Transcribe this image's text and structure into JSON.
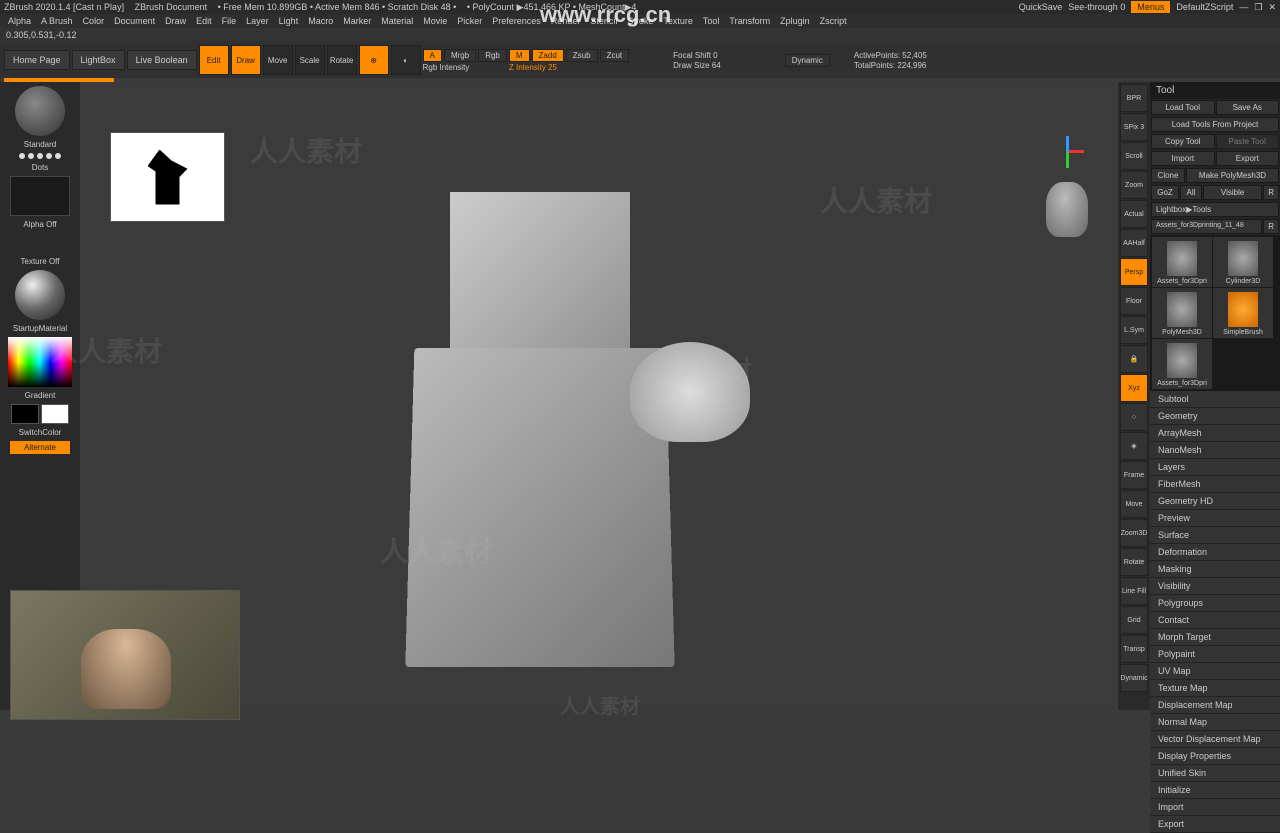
{
  "titlebar": {
    "app": "ZBrush 2020.1.4 [Cast n Play]",
    "doc": "ZBrush Document",
    "mem": "• Free Mem 10.899GB • Active Mem 846 • Scratch Disk 48 •",
    "poly": "• PolyCount ▶451,466 KP • MeshCount▶4",
    "quicksave": "QuickSave",
    "seethrough": "See-through   0",
    "menus": "Menus",
    "script": "DefaultZScript"
  },
  "menubar": [
    "Alpha",
    "A Brush",
    "Color",
    "Document",
    "Draw",
    "Edit",
    "File",
    "Layer",
    "Light",
    "Macro",
    "Marker",
    "Material",
    "Movie",
    "Picker",
    "Preferences",
    "Render",
    "Stencil",
    "Stroke",
    "Texture",
    "Tool",
    "Transform",
    "Zplugin",
    "Zscript"
  ],
  "coords": "0.305,0.531,-0.12",
  "toolbar": {
    "home": "Home Page",
    "lightbox": "LightBox",
    "liveBool": "Live Boolean",
    "edit": "Edit",
    "draw": "Draw",
    "move": "Move",
    "scale": "Scale",
    "rotate": "Rotate",
    "mrgb_a": "A",
    "mrgb": "Mrgb",
    "rgb": "Rgb",
    "m": "M",
    "zadd": "Zadd",
    "zsub": "Zsub",
    "zcut": "Zcut",
    "rgbInt": "Rgb Intensity",
    "zInt": "Z Intensity 25",
    "focal": "Focal Shift 0",
    "drawSize": "Draw Size  64",
    "dynamic": "Dynamic",
    "activePts": "ActivePoints: 52,405",
    "totalPts": "TotalPoints: 224,996"
  },
  "left": {
    "brush": "Standard",
    "stroke": "Dots",
    "alpha": "Alpha Off",
    "texture": "Texture Off",
    "material": "StartupMaterial",
    "gradient": "Gradient",
    "switch": "SwitchColor",
    "alternate": "Alternate"
  },
  "rightTools": [
    "BPR",
    "SPix 3",
    "Scroll",
    "Zoom",
    "Actual",
    "AAHalf",
    "Persp",
    "Floor",
    "L.Sym",
    "🔒",
    "Xyz",
    "○",
    "◈",
    "Frame",
    "Move",
    "Zoom3D",
    "Rotate",
    "Line Fill",
    "Grid",
    "Transp",
    "Dynamic"
  ],
  "panel": {
    "title": "Tool",
    "loadTool": "Load Tool",
    "saveAs": "Save As",
    "loadProject": "Load Tools From Project",
    "copyTool": "Copy Tool",
    "pasteTool": "Paste Tool",
    "import": "Import",
    "export": "Export",
    "clone": "Clone",
    "makePoly": "Make PolyMesh3D",
    "goz": "GoZ",
    "all": "All",
    "visible": "Visible",
    "r": "R",
    "lightbox": "Lightbox▶Tools",
    "current": "Assets_for3Dprinting_11_48",
    "thumbs": [
      "Assets_for3Dpri",
      "Cylinder3D",
      "PolyMesh3D",
      "SimpleBrush",
      "Assets_for3Dpri"
    ],
    "sections": [
      "Subtool",
      "Geometry",
      "ArrayMesh",
      "NanoMesh",
      "Layers",
      "FiberMesh",
      "Geometry HD",
      "Preview",
      "Surface",
      "Deformation",
      "Masking",
      "Visibility",
      "Polygroups",
      "Contact",
      "Morph Target",
      "Polypaint",
      "UV Map",
      "Texture Map",
      "Displacement Map",
      "Normal Map",
      "Vector Displacement Map",
      "Display Properties",
      "Unified Skin",
      "Initialize",
      "Import",
      "Export"
    ]
  },
  "watermark_url": "www.rrcg.cn",
  "watermark_cn": "人人素材"
}
